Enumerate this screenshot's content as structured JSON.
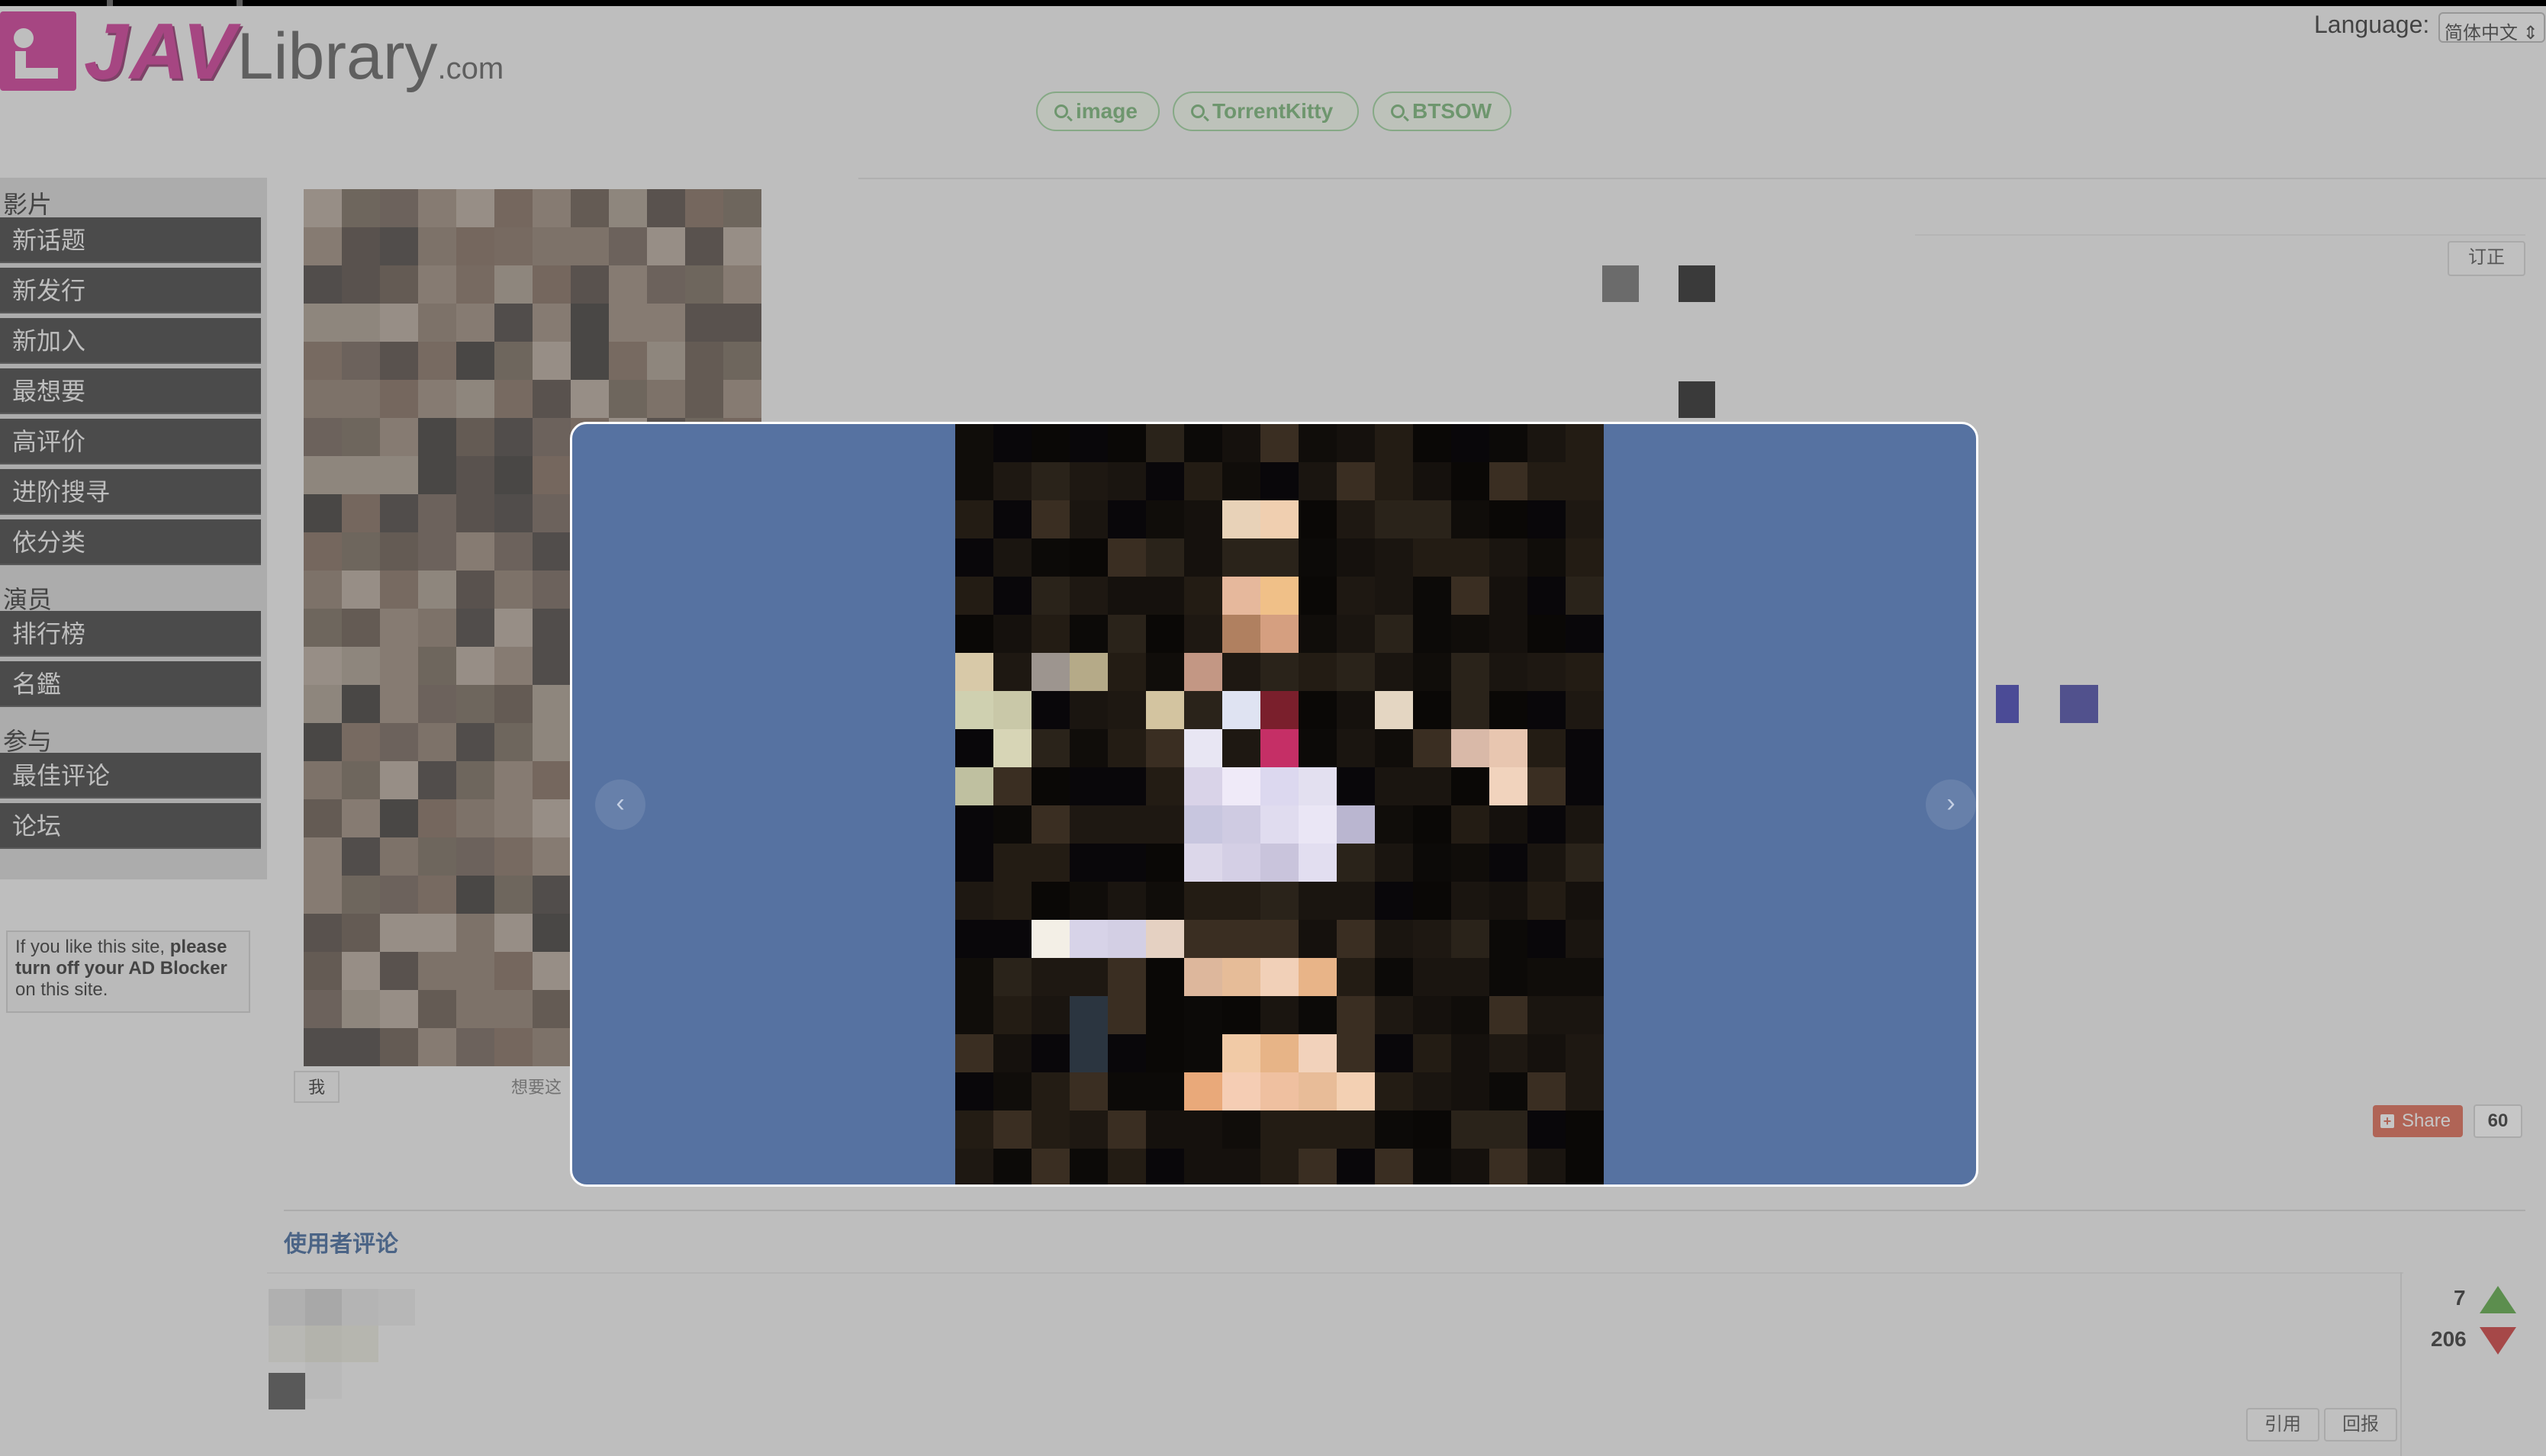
{
  "header": {
    "logo_jav": "JAV",
    "logo_library": "Library",
    "logo_com": ".com",
    "language_label": "Language:",
    "language_value": "简体中文 ⇕"
  },
  "search_links": [
    {
      "label": "image"
    },
    {
      "label": "TorrentKitty"
    },
    {
      "label": "BTSOW"
    }
  ],
  "sidebar": {
    "sections": [
      {
        "title": "影片",
        "items": [
          "新话题",
          "新发行",
          "新加入",
          "最想要",
          "高评价",
          "进阶搜寻",
          "依分类"
        ]
      },
      {
        "title": "演员",
        "items": [
          "排行榜",
          "名鑑"
        ]
      },
      {
        "title": "参与",
        "items": [
          "最佳评论",
          "论坛"
        ]
      }
    ],
    "ad_notice_1": "If you like this site, ",
    "ad_notice_2": "please turn off your AD Blocker",
    "ad_notice_3": " on this site."
  },
  "video": {
    "edit_label": "订正",
    "poster_caption_left": "我",
    "poster_caption_right": "想要这"
  },
  "share": {
    "label": "Share",
    "count": "60"
  },
  "comments": {
    "title": "使用者评论",
    "votes_up": "7",
    "votes_down": "206",
    "quote_label": "引用",
    "report_label": "回报"
  },
  "lightbox": {
    "prev_icon": "‹",
    "next_icon": "›"
  },
  "colors": {
    "brand": "#c51684",
    "modal_bg": "#5672a1",
    "pill_green": "#5fa85f",
    "share_red": "#d84d33"
  }
}
